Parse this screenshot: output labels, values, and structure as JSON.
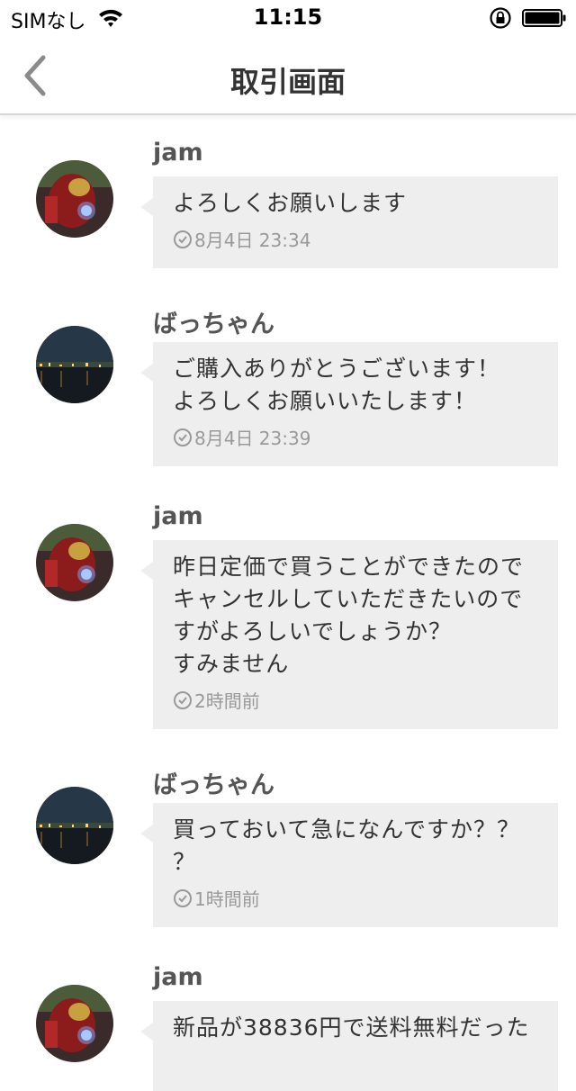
{
  "status_bar": {
    "carrier": "SIMなし",
    "time": "11:15"
  },
  "nav": {
    "title": "取引画面",
    "back_icon": "chevron-left-icon"
  },
  "colors": {
    "bubble": "#eeeeee",
    "sender": "#555555",
    "timestamp": "#999999"
  },
  "messages": [
    {
      "sender": "jam",
      "avatar": "ironman-avatar",
      "text": "よろしくお願いします",
      "time": "8月4日 23:34"
    },
    {
      "sender": "ばっちゃん",
      "avatar": "night-city-avatar",
      "text": "ご購入ありがとうございます！\nよろしくお願いいたします！",
      "time": "8月4日 23:39"
    },
    {
      "sender": "jam",
      "avatar": "ironman-avatar",
      "text": "昨日定価で買うことができたので\nキャンセルしていただきたいので\nすがよろしいでしょうか？\nすみません",
      "time": "2時間前"
    },
    {
      "sender": "ばっちゃん",
      "avatar": "night-city-avatar",
      "text": "買っておいて急になんですか？？\n？",
      "time": "1時間前"
    },
    {
      "sender": "jam",
      "avatar": "ironman-avatar",
      "text": "新品が38836円で送料無料だった",
      "time": ""
    }
  ]
}
